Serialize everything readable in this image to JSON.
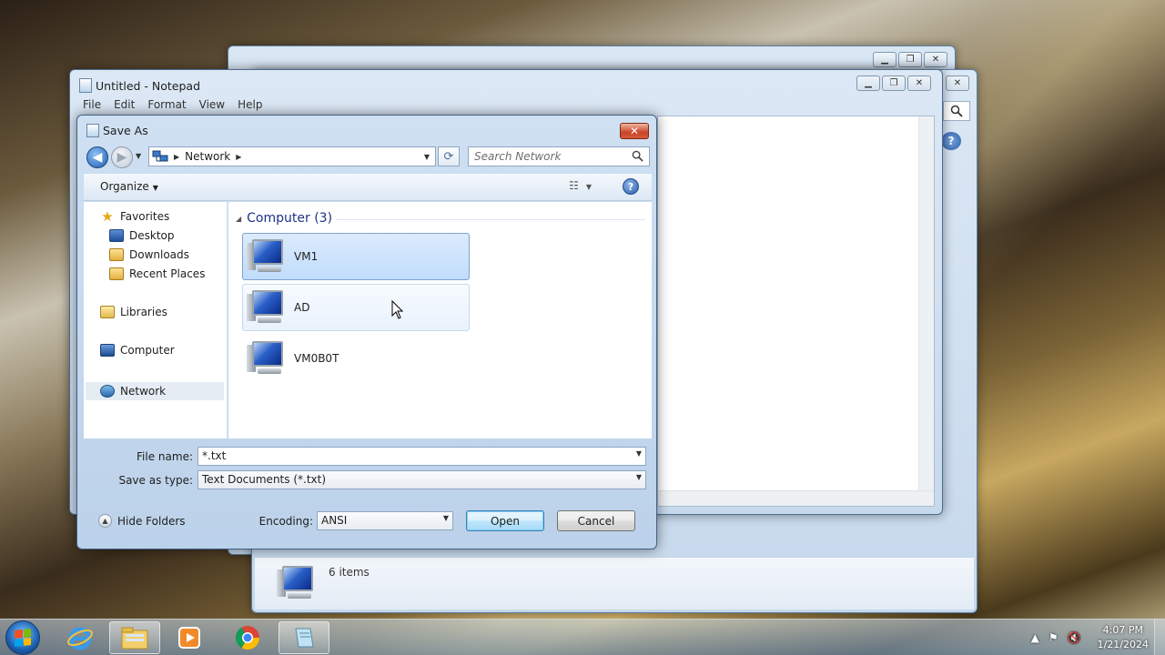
{
  "notepad": {
    "title": "Untitled - Notepad",
    "menu": [
      "File",
      "Edit",
      "Format",
      "View",
      "Help"
    ]
  },
  "explorer": {
    "status_text": "6 items"
  },
  "dialog": {
    "title": "Save As",
    "address": {
      "location": "Network"
    },
    "search_placeholder": "Search Network",
    "organize_label": "Organize",
    "nav": {
      "favorites": "Favorites",
      "desktop": "Desktop",
      "downloads": "Downloads",
      "recent_places": "Recent Places",
      "libraries": "Libraries",
      "computer": "Computer",
      "network": "Network"
    },
    "group_header": "Computer (3)",
    "computers": [
      "VM1",
      "AD",
      "VM0B0T"
    ],
    "file_name_label": "File name:",
    "file_name_value": "*.txt",
    "save_type_label": "Save as type:",
    "save_type_value": "Text Documents (*.txt)",
    "hide_folders_label": "Hide Folders",
    "encoding_label": "Encoding:",
    "encoding_value": "ANSI",
    "open_label": "Open",
    "cancel_label": "Cancel"
  },
  "taskbar": {
    "time": "4:07 PM",
    "date": "1/21/2024",
    "apps": [
      "internet-explorer",
      "file-explorer",
      "media-player",
      "chrome",
      "notepad"
    ]
  }
}
